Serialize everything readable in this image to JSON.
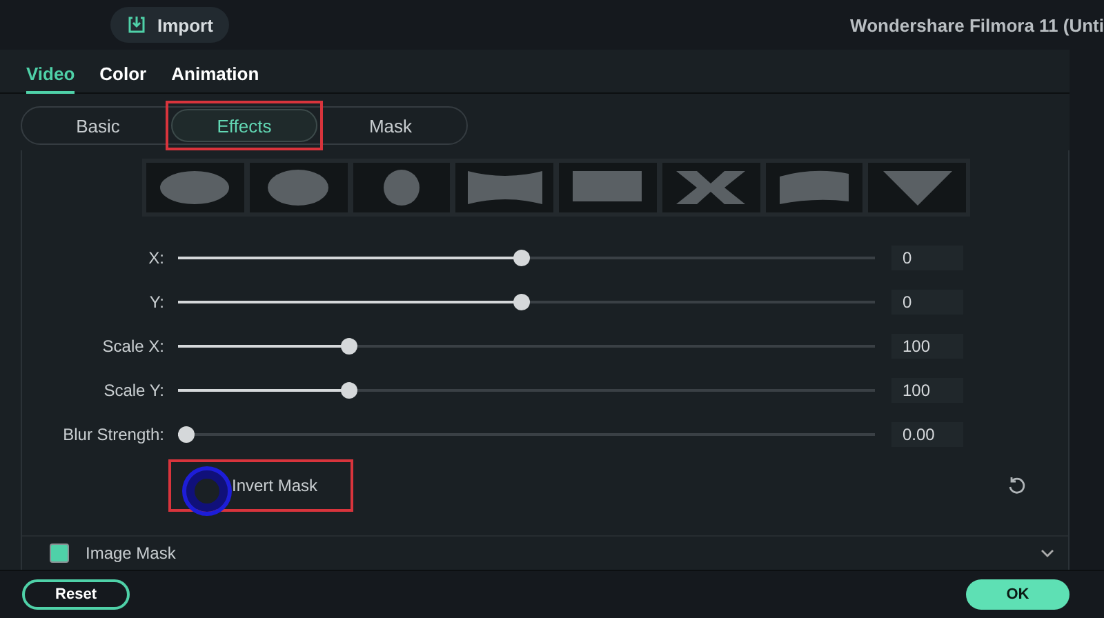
{
  "topbar": {
    "import_button": "Import",
    "title": "Wondershare Filmora 11 (Unti"
  },
  "tabs": [
    {
      "label": "Video",
      "selected": true
    },
    {
      "label": "Color",
      "selected": false
    },
    {
      "label": "Animation",
      "selected": false
    }
  ],
  "subtabs": [
    {
      "label": "Basic",
      "selected": false,
      "annotated": false
    },
    {
      "label": "Effects",
      "selected": true,
      "annotated": true
    },
    {
      "label": "Mask",
      "selected": false,
      "annotated": false
    }
  ],
  "mask_shapes": [
    {
      "kind": "cloud"
    },
    {
      "kind": "ellipse"
    },
    {
      "kind": "flower"
    },
    {
      "kind": "bowtie"
    },
    {
      "kind": "rect"
    },
    {
      "kind": "cross"
    },
    {
      "kind": "wave"
    },
    {
      "kind": "triangle"
    }
  ],
  "sliders": [
    {
      "label": "X:",
      "level": 0.493,
      "value": "0"
    },
    {
      "label": "Y:",
      "level": 0.493,
      "value": "0"
    },
    {
      "label": "Scale X:",
      "level": 0.246,
      "value": "100"
    },
    {
      "label": "Scale Y:",
      "level": 0.246,
      "value": "100"
    },
    {
      "label": "Blur Strength:",
      "level": 0.012,
      "value": "0.00"
    }
  ],
  "invert_mask": {
    "label": "Invert Mask",
    "annotated": true,
    "click_highlight": true
  },
  "image_mask": {
    "label": "Image Mask",
    "checked": true,
    "expanded": false
  },
  "footer": {
    "reset": "Reset",
    "ok": "OK"
  }
}
